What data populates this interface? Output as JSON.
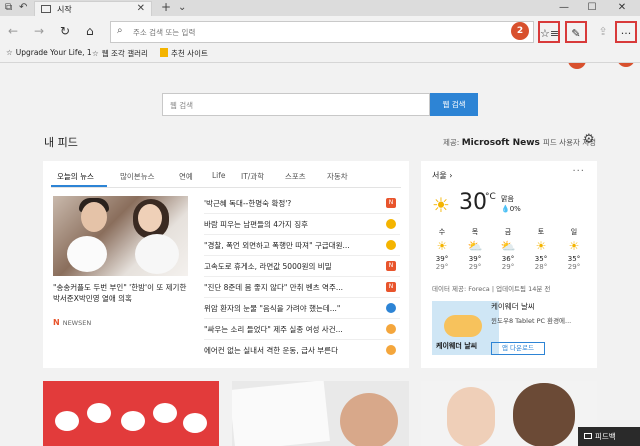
{
  "tab": {
    "title": "시작"
  },
  "toolbar": {
    "address_placeholder": "주소 검색 또는 입력",
    "callouts": [
      "2",
      "3",
      "1"
    ]
  },
  "favorites": [
    {
      "label": "Upgrade Your Life, 1"
    },
    {
      "label": "웹 조각 갤러리"
    },
    {
      "label": "추천 사이트"
    }
  ],
  "search": {
    "placeholder": "웹 검색",
    "button": "웹 검색"
  },
  "feed": {
    "title": "내 피드",
    "provider_prefix": "제공:",
    "provider": "Microsoft News",
    "settings_label": "피드 사용자 지정",
    "categories": [
      "오늘의 뉴스",
      "많이본뉴스",
      "연예",
      "Life",
      "IT/과학",
      "스포츠",
      "자동차"
    ],
    "hero_caption": "\"송송커플도 두번 부인\" '한밤'이 또 제기한 박서준X박민영 열애 의혹",
    "source": "NEWSEN",
    "headlines": [
      {
        "text": "'박근혜 독대--한명숙 확정'?",
        "color": "#e8542c",
        "mark": "N"
      },
      {
        "text": "바람 피우는 남편들의 4가지 징후",
        "color": "#f4b400",
        "mark": ""
      },
      {
        "text": "\"경찰, 폭언 외면하고 폭행만 따져\" 구급대원...",
        "color": "#f4b400",
        "mark": ""
      },
      {
        "text": "고속도로 휴게소, 라면값 5000원의 비밀",
        "color": "#e8542c",
        "mark": "N"
      },
      {
        "text": "\"진단 8준데 몸 좋지 않다\" 만취 벤츠 역주...",
        "color": "#e8542c",
        "mark": "N"
      },
      {
        "text": "위암 환자의 눈물 \"음식을 가려야 했는데...\"",
        "color": "#2d84d5",
        "mark": ""
      },
      {
        "text": "\"싸우는 소리 들었다\" 제주 실종 여성 사건...",
        "color": "#f4a63c",
        "mark": ""
      },
      {
        "text": "에어컨 없는 실내서 격한 운동, 급사 부른다",
        "color": "#f4a63c",
        "mark": ""
      }
    ]
  },
  "weather": {
    "city": "서울",
    "more": "···",
    "temp": "30",
    "unit": "°C",
    "condition": "맑음",
    "precip": "0%",
    "days": [
      {
        "day": "수",
        "icon": "sun",
        "hi": "39°",
        "lo": "29°"
      },
      {
        "day": "목",
        "icon": "partly-cloudy",
        "hi": "39°",
        "lo": "29°"
      },
      {
        "day": "금",
        "icon": "partly-cloudy",
        "hi": "36°",
        "lo": "29°"
      },
      {
        "day": "토",
        "icon": "sun",
        "hi": "35°",
        "lo": "28°"
      },
      {
        "day": "일",
        "icon": "sun",
        "hi": "35°",
        "lo": "29°"
      }
    ],
    "source": "데이터 제공: Foreca | 업데이트됨 14분 전",
    "ad": {
      "image_text": "케이웨더 날씨",
      "title": "케이웨더 날씨",
      "desc": "윈도우8 Tablet PC 환경에...",
      "button": "앱 다운로드"
    }
  },
  "feedback": {
    "label": "피드백"
  }
}
